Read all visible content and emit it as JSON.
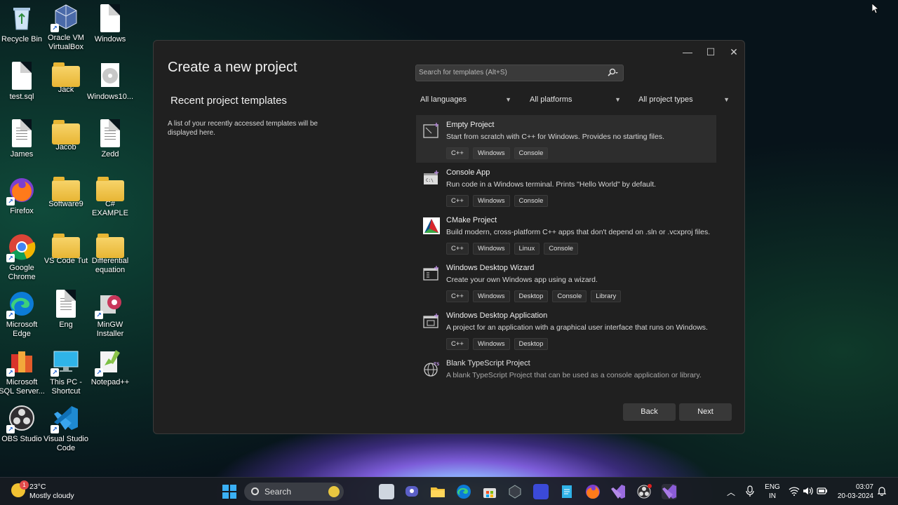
{
  "desktop": {
    "icons": [
      {
        "label": "Recycle Bin",
        "icon": "recycle-bin-icon"
      },
      {
        "label": "Oracle VM VirtualBox",
        "icon": "virtualbox-icon"
      },
      {
        "label": "Windows",
        "icon": "document-icon"
      },
      {
        "label": "test.sql",
        "icon": "document-icon"
      },
      {
        "label": "Jack",
        "icon": "folder-icon"
      },
      {
        "label": "Windows10...",
        "icon": "disc-image-icon"
      },
      {
        "label": "James",
        "icon": "text-document-icon"
      },
      {
        "label": "Jacob",
        "icon": "folder-icon"
      },
      {
        "label": "Zedd",
        "icon": "text-document-icon"
      },
      {
        "label": "Firefox",
        "icon": "firefox-icon"
      },
      {
        "label": "Software9",
        "icon": "folder-icon"
      },
      {
        "label": "C# EXAMPLE",
        "icon": "folder-icon"
      },
      {
        "label": "Google Chrome",
        "icon": "chrome-icon"
      },
      {
        "label": "VS Code Tut",
        "icon": "folder-icon"
      },
      {
        "label": "Differential equation",
        "icon": "folder-icon"
      },
      {
        "label": "Microsoft Edge",
        "icon": "edge-icon"
      },
      {
        "label": "Eng",
        "icon": "text-document-icon"
      },
      {
        "label": "MinGW Installer",
        "icon": "mingw-icon"
      },
      {
        "label": "Microsoft SQL Server...",
        "icon": "sql-server-icon"
      },
      {
        "label": "This PC - Shortcut",
        "icon": "this-pc-icon"
      },
      {
        "label": "Notepad++",
        "icon": "notepad-plus-plus-icon"
      },
      {
        "label": "OBS Studio",
        "icon": "obs-icon"
      },
      {
        "label": "Visual Studio Code",
        "icon": "vscode-icon"
      }
    ]
  },
  "dialog": {
    "title": "Create a new project",
    "recent_heading": "Recent project templates",
    "recent_text": "A list of your recently accessed templates will be displayed here.",
    "search_placeholder": "Search for templates (Alt+S)",
    "filters": {
      "language": "All languages",
      "platform": "All platforms",
      "project_type": "All project types"
    },
    "templates": [
      {
        "name": "Empty Project",
        "description": "Start from scratch with C++ for Windows. Provides no starting files.",
        "tags": [
          "C++",
          "Windows",
          "Console"
        ],
        "selected": true
      },
      {
        "name": "Console App",
        "description": "Run code in a Windows terminal. Prints \"Hello World\" by default.",
        "tags": [
          "C++",
          "Windows",
          "Console"
        ]
      },
      {
        "name": "CMake Project",
        "description": "Build modern, cross-platform C++ apps that don't depend on .sln or .vcxproj files.",
        "tags": [
          "C++",
          "Windows",
          "Linux",
          "Console"
        ]
      },
      {
        "name": "Windows Desktop Wizard",
        "description": "Create your own Windows app using a wizard.",
        "tags": [
          "C++",
          "Windows",
          "Desktop",
          "Console",
          "Library"
        ]
      },
      {
        "name": "Windows Desktop Application",
        "description": "A project for an application with a graphical user interface that runs on Windows.",
        "tags": [
          "C++",
          "Windows",
          "Desktop"
        ]
      },
      {
        "name": "Blank TypeScript Project",
        "description": "A blank TypeScript Project that can be used as a console application or library.",
        "tags": []
      }
    ],
    "back_label": "Back",
    "next_label": "Next"
  },
  "taskbar": {
    "weather_temp": "23°C",
    "weather_desc": "Mostly cloudy",
    "weather_badge": "1",
    "search_label": "Search",
    "language_line1": "ENG",
    "language_line2": "IN",
    "time": "03:07",
    "date": "20-03-2024"
  }
}
